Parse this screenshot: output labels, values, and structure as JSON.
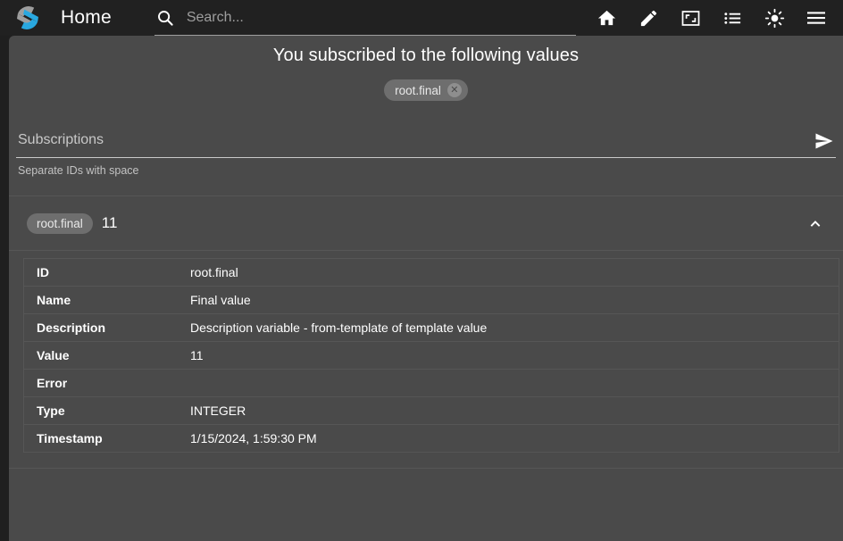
{
  "appbar": {
    "logo_icon": "scada-s-logo-icon",
    "title": "Home",
    "search": {
      "icon": "search-icon",
      "placeholder": "Search...",
      "value": ""
    },
    "tools": [
      {
        "name": "home-icon",
        "label": "Home"
      },
      {
        "name": "edit-pencil-icon",
        "label": "Edit"
      },
      {
        "name": "fullscreen-icon",
        "label": "Fullscreen"
      },
      {
        "name": "list-icon",
        "label": "List"
      },
      {
        "name": "brightness-sun-icon",
        "label": "Brightness"
      },
      {
        "name": "hamburger-menu-icon",
        "label": "Menu"
      }
    ]
  },
  "content": {
    "subscribed_title": "You subscribed to the following values",
    "subscribed_chips": [
      {
        "label": "root.final",
        "remove_glyph": "✕"
      }
    ],
    "subscriptions_field": {
      "placeholder": "Subscriptions",
      "value": "",
      "hint": "Separate IDs with space",
      "send_icon": "send-arrow-icon"
    },
    "panel": {
      "chip_label": "root.final",
      "value": "11",
      "toggle_icon": "chevron-up-icon",
      "expanded": true,
      "details": [
        {
          "key": "ID",
          "value": "root.final"
        },
        {
          "key": "Name",
          "value": "Final value"
        },
        {
          "key": "Description",
          "value": "Description variable - from-template of template value"
        },
        {
          "key": "Value",
          "value": "11"
        },
        {
          "key": "Error",
          "value": ""
        },
        {
          "key": "Type",
          "value": "INTEGER"
        },
        {
          "key": "Timestamp",
          "value": "1/15/2024, 1:59:30 PM"
        }
      ]
    }
  },
  "colors": {
    "appbar_bg": "#212121",
    "page_bg": "#1f1f1f",
    "card_bg": "#4a4a4a",
    "chip_bg": "#6e6e6e",
    "accent_blue": "#29a8e0",
    "logo_gray": "#9e9e9e",
    "text_primary": "#ffffff",
    "divider": "#565656"
  }
}
